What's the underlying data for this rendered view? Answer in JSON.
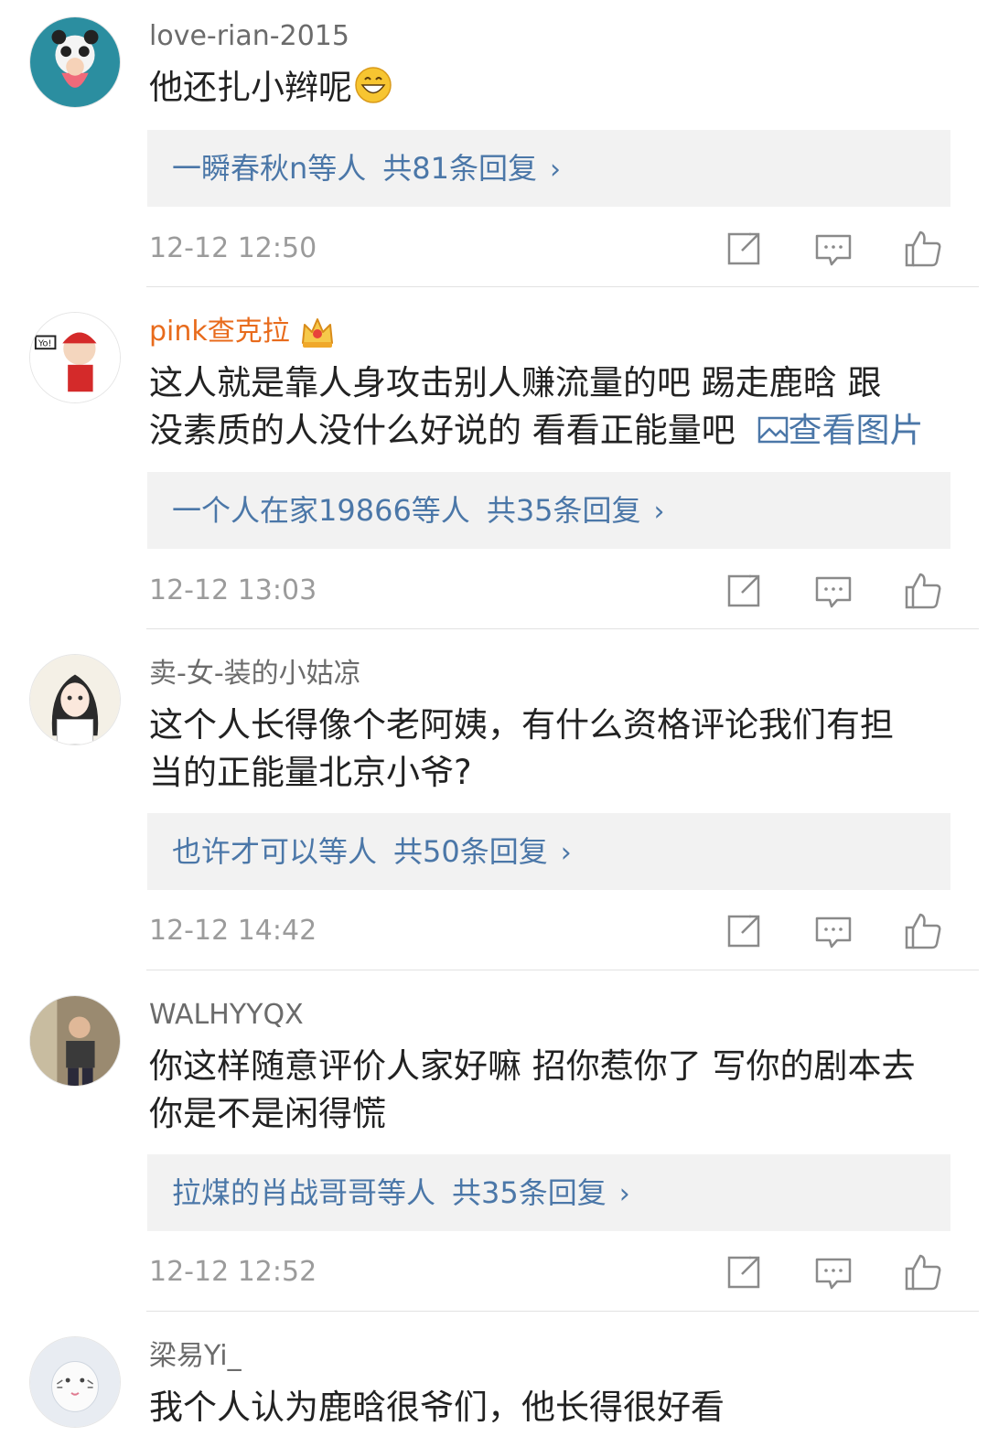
{
  "comments": [
    {
      "username": "love-rian-2015",
      "text": "他还扎小辫呢",
      "emoji": "grinning-emoji",
      "reply_names": "一瞬春秋n等人",
      "reply_count": "共81条回复",
      "time": "12-12 12:50"
    },
    {
      "username": "pink查克拉",
      "badge": "crown-badge",
      "text_line1": "这人就是靠人身攻击别人赚流量的吧 踢走鹿晗 跟",
      "text_line2": "没素质的人没什么好说的 看看正能量吧 ",
      "pic_link": "查看图片",
      "reply_names": "一个人在家19866等人",
      "reply_count": "共35条回复",
      "time": "12-12 13:03"
    },
    {
      "username": "卖-女-装的小姑凉",
      "text_line1": "这个人长得像个老阿姨，有什么资格评论我们有担",
      "text_line2": "当的正能量北京小爷?",
      "reply_names": "也许才可以等人",
      "reply_count": "共50条回复",
      "time": "12-12 14:42"
    },
    {
      "username": "WALHYYQX",
      "text_line1": "你这样随意评价人家好嘛 招你惹你了 写你的剧本去",
      "text_line2": "你是不是闲得慌",
      "reply_names": "拉煤的肖战哥哥等人",
      "reply_count": "共35条回复",
      "time": "12-12 12:52"
    },
    {
      "username": "梁易Yi_",
      "text": "我个人认为鹿晗很爷们，他长得很好看"
    }
  ],
  "icons": {
    "share": "share-icon",
    "reply": "comment-icon",
    "like": "thumbs-up-icon",
    "chevron": "›"
  },
  "colors": {
    "link": "#4b77a8",
    "vip_name": "#e86b1c",
    "reply_bg": "#f2f2f2"
  }
}
